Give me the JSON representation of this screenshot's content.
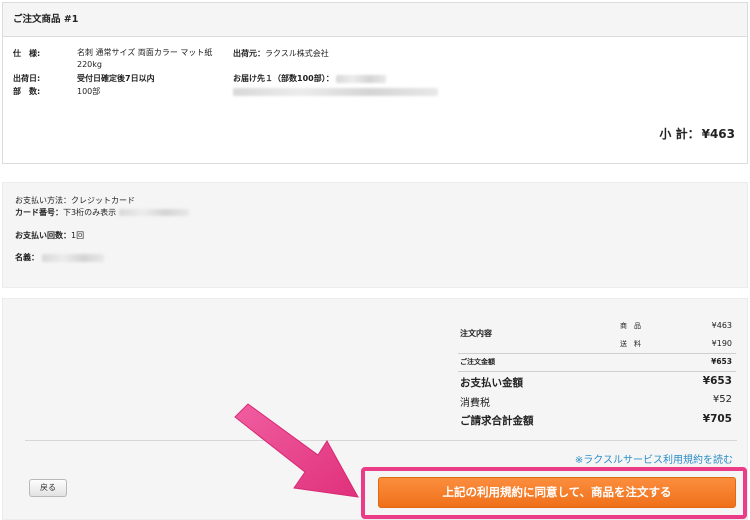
{
  "order_item": {
    "heading": "ご注文商品 #1",
    "spec_label": "仕　様:",
    "spec_value": "名刺 通常サイズ 両面カラー マット紙 220kg",
    "ship_date_label": "出荷日:",
    "ship_date_value": "受付日確定後7日以内",
    "quantity_label": "部　数:",
    "quantity_value": "100部",
    "shipper_label": "出荷元：",
    "shipper_value": "ラクスル株式会社",
    "destination_label": "お届け先１（部数100部）：",
    "subtotal_label": "小 計：",
    "subtotal_value": "¥463"
  },
  "payment": {
    "method_label": "お支払い方法：",
    "method_value": "クレジットカード",
    "card_label": "カード番号：",
    "card_value": "下3桁のみ表示",
    "installments_label": "お支払い回数：",
    "installments_value": "1回",
    "holder_label": "名義："
  },
  "summary": {
    "order_contents_label": "注文内容",
    "product_label": "商　品",
    "product_value": "¥463",
    "shipping_label": "送　料",
    "shipping_value": "¥190",
    "order_total_label": "ご注文金額",
    "order_total_value": "¥653",
    "payment_amount_label": "お支払い金額",
    "payment_amount_value": "¥653",
    "tax_label": "消費税",
    "tax_value": "¥52",
    "grand_total_label": "ご請求合計金額",
    "grand_total_value": "¥705"
  },
  "terms_link": "※ラクスルサービス利用規約を読む",
  "back_button": "戻る",
  "order_button": "上記の利用規約に同意して、商品を注文する",
  "colors": {
    "order_button": "#f47b20",
    "highlight": "#ea3c87",
    "link": "#2d8ec8"
  },
  "icons": {
    "annotation": "pink-arrow"
  }
}
